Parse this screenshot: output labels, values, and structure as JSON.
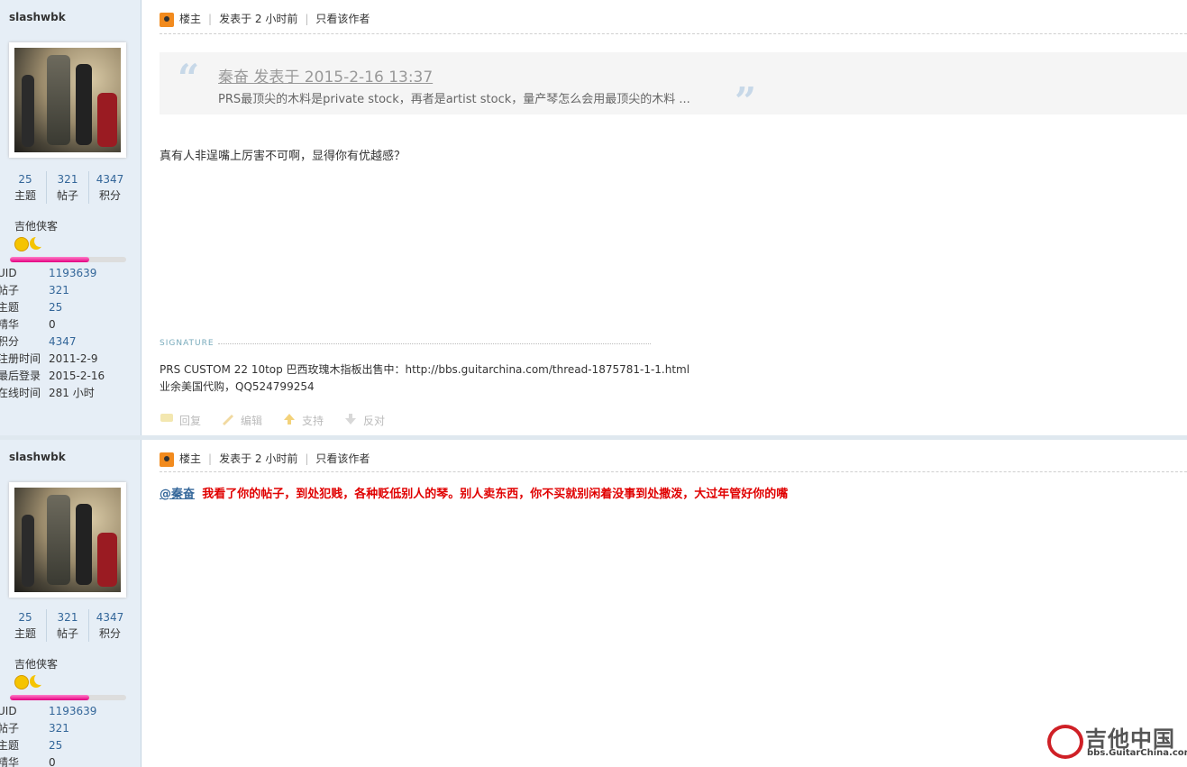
{
  "post1": {
    "user": {
      "name": "slashwbk",
      "stats": [
        {
          "n": "25",
          "l": "主题"
        },
        {
          "n": "321",
          "l": "帖子"
        },
        {
          "n": "4347",
          "l": "积分"
        }
      ],
      "rank": "吉他侠客",
      "progress": 0.68,
      "info": [
        {
          "k": "UID",
          "v": "1193639",
          "link": true
        },
        {
          "k": "帖子",
          "v": "321",
          "link": true
        },
        {
          "k": "主题",
          "v": "25",
          "link": true
        },
        {
          "k": "精华",
          "v": "0",
          "link": false
        },
        {
          "k": "积分",
          "v": "4347",
          "link": true
        },
        {
          "k": "注册时间",
          "v": "2011-2-9",
          "link": false
        },
        {
          "k": "最后登录",
          "v": "2015-2-16",
          "link": false
        },
        {
          "k": "在线时间",
          "v": "281 小时",
          "link": false
        }
      ]
    },
    "header": {
      "role": "楼主",
      "posted": "发表于 2 小时前",
      "only_author": "只看该作者"
    },
    "quote": {
      "title": "秦奋 发表于 2015-2-16 13:37",
      "body": "PRS最顶尖的木料是private stock，再者是artist stock，量产琴怎么会用最顶尖的木料 ..."
    },
    "content": "真有人非逞嘴上厉害不可啊，显得你有优越感？",
    "signature_label": "SIGNATURE",
    "signature": [
      "PRS CUSTOM 22 10top 巴西玫瑰木指板出售中：http://bbs.guitarchina.com/thread-1875781-1-1.html",
      "业余美国代购，QQ524799254"
    ],
    "actions": [
      "回复",
      "编辑",
      "支持",
      "反对"
    ]
  },
  "post2": {
    "user": {
      "name": "slashwbk",
      "stats": [
        {
          "n": "25",
          "l": "主题"
        },
        {
          "n": "321",
          "l": "帖子"
        },
        {
          "n": "4347",
          "l": "积分"
        }
      ],
      "rank": "吉他侠客",
      "progress": 0.68,
      "info": [
        {
          "k": "UID",
          "v": "1193639",
          "link": true
        },
        {
          "k": "帖子",
          "v": "321",
          "link": true
        },
        {
          "k": "主题",
          "v": "25",
          "link": true
        },
        {
          "k": "精华",
          "v": "0",
          "link": false
        }
      ]
    },
    "header": {
      "role": "楼主",
      "posted": "发表于 2 小时前",
      "only_author": "只看该作者"
    },
    "mention": "@秦奋",
    "content": "我看了你的帖子，到处犯贱，各种贬低别人的琴。别人卖东西，你不买就别闲着没事到处撒泼，大过年管好你的嘴"
  },
  "watermark": {
    "cn": "吉他中国",
    "url": "bbs.GuitarChina.com"
  },
  "colors": {
    "link": "#336699",
    "sidebar": "#e6eef6",
    "red_text": "#e00000",
    "progress": "#e4007f"
  }
}
